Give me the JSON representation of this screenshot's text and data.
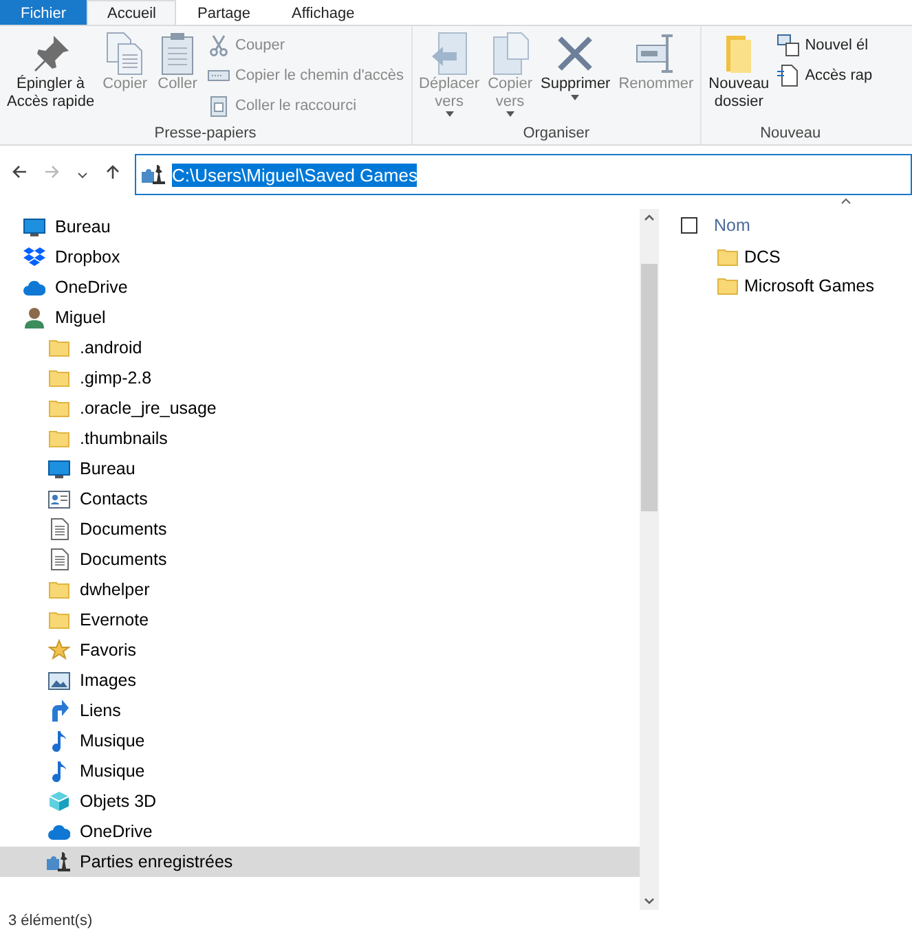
{
  "tabs": [
    {
      "label": "Fichier",
      "selected": false,
      "kind": "file"
    },
    {
      "label": "Accueil",
      "selected": true,
      "kind": "tab"
    },
    {
      "label": "Partage",
      "selected": false,
      "kind": "tab"
    },
    {
      "label": "Affichage",
      "selected": false,
      "kind": "tab"
    }
  ],
  "ribbon": {
    "groups": [
      {
        "label": "Presse-papiers",
        "large": [
          {
            "label": "Épingler à\nAccès rapide",
            "kind": "pin",
            "disabled": false
          },
          {
            "label": "Copier",
            "kind": "copy",
            "disabled": true
          },
          {
            "label": "Coller",
            "kind": "paste",
            "disabled": true
          }
        ],
        "small": [
          {
            "label": "Couper",
            "kind": "cut",
            "disabled": true
          },
          {
            "label": "Copier le chemin d'accès",
            "kind": "path",
            "disabled": true
          },
          {
            "label": "Coller le raccourci",
            "kind": "shortcut",
            "disabled": true
          }
        ]
      },
      {
        "label": "Organiser",
        "large": [
          {
            "label": "Déplacer\nvers",
            "kind": "move",
            "disabled": true,
            "dropdown": true
          },
          {
            "label": "Copier\nvers",
            "kind": "copyto",
            "disabled": true,
            "dropdown": true
          },
          {
            "label": "Supprimer",
            "kind": "delete",
            "disabled": false,
            "dropdown": true
          },
          {
            "label": "Renommer",
            "kind": "rename",
            "disabled": true
          }
        ]
      },
      {
        "label": "Nouveau",
        "large": [
          {
            "label": "Nouveau\ndossier",
            "kind": "newfolder",
            "disabled": false
          }
        ],
        "small": [
          {
            "label": "Nouvel él",
            "kind": "newitem",
            "disabled": false
          },
          {
            "label": "Accès rap",
            "kind": "easyaccess",
            "disabled": false
          }
        ]
      }
    ]
  },
  "address": {
    "value": "C:\\Users\\Miguel\\Saved Games"
  },
  "nav_tree": [
    {
      "label": "Bureau",
      "kind": "desktop",
      "selected": false
    },
    {
      "label": "Dropbox",
      "kind": "dropbox",
      "selected": false
    },
    {
      "label": "OneDrive",
      "kind": "cloud",
      "selected": false
    },
    {
      "label": "Miguel",
      "kind": "user",
      "selected": false,
      "children": [
        {
          "label": ".android",
          "kind": "folder",
          "selected": false
        },
        {
          "label": ".gimp-2.8",
          "kind": "folder",
          "selected": false
        },
        {
          "label": ".oracle_jre_usage",
          "kind": "folder",
          "selected": false
        },
        {
          "label": ".thumbnails",
          "kind": "folder",
          "selected": false
        },
        {
          "label": "Bureau",
          "kind": "desktop",
          "selected": false
        },
        {
          "label": "Contacts",
          "kind": "contacts",
          "selected": false
        },
        {
          "label": "Documents",
          "kind": "document",
          "selected": false
        },
        {
          "label": "Documents",
          "kind": "document",
          "selected": false
        },
        {
          "label": "dwhelper",
          "kind": "folder",
          "selected": false
        },
        {
          "label": "Evernote",
          "kind": "folder",
          "selected": false
        },
        {
          "label": "Favoris",
          "kind": "star",
          "selected": false
        },
        {
          "label": "Images",
          "kind": "images",
          "selected": false
        },
        {
          "label": "Liens",
          "kind": "link",
          "selected": false
        },
        {
          "label": "Musique",
          "kind": "music",
          "selected": false
        },
        {
          "label": "Musique",
          "kind": "music",
          "selected": false
        },
        {
          "label": "Objets 3D",
          "kind": "cube",
          "selected": false
        },
        {
          "label": "OneDrive",
          "kind": "cloud",
          "selected": false
        },
        {
          "label": "Parties enregistrées",
          "kind": "games",
          "selected": true
        }
      ]
    }
  ],
  "file_list": {
    "select_all": {
      "checked": false
    },
    "columns": [
      {
        "label": "Nom"
      }
    ],
    "items": [
      {
        "name": "DCS",
        "kind": "folder"
      },
      {
        "name": "Microsoft Games",
        "kind": "folder"
      }
    ]
  },
  "status_bar": {
    "text": "3 élément(s)"
  }
}
